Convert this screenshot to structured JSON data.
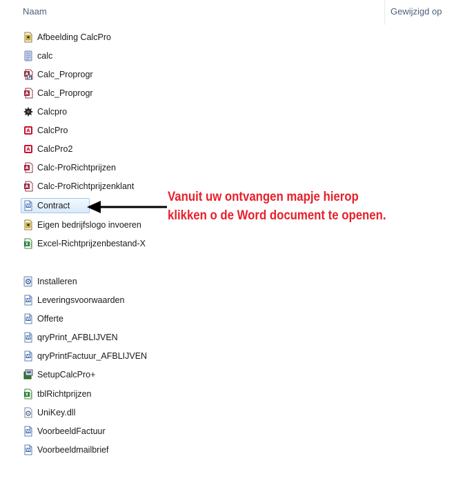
{
  "header": {
    "name_col": "Naam",
    "date_col": "Gewijzigd op"
  },
  "files": [
    {
      "name": "Afbeelding CalcPro",
      "icon": "image-file-icon"
    },
    {
      "name": "calc",
      "icon": "text-file-icon"
    },
    {
      "name": "Calc_Proprogr",
      "icon": "access-shortcut-icon"
    },
    {
      "name": "Calc_Proprogr",
      "icon": "access-db-icon"
    },
    {
      "name": "Calcpro",
      "icon": "program-icon"
    },
    {
      "name": "CalcPro",
      "icon": "access-app-icon"
    },
    {
      "name": "CalcPro2",
      "icon": "access-app-icon"
    },
    {
      "name": "Calc-ProRichtprijzen",
      "icon": "access-db-icon"
    },
    {
      "name": "Calc-ProRichtprijzenklant",
      "icon": "access-db-icon"
    },
    {
      "name": "Contract",
      "icon": "word-doc-icon"
    },
    {
      "name": "Eigen bedrijfslogo invoeren",
      "icon": "image-file-icon"
    },
    {
      "name": "Excel-Richtprijzenbestand-X",
      "icon": "excel-file-icon"
    },
    {
      "name": "Installeren",
      "icon": "setup-config-icon"
    },
    {
      "name": "Leveringsvoorwaarden",
      "icon": "word-doc-icon"
    },
    {
      "name": "Offerte",
      "icon": "word-doc-icon"
    },
    {
      "name": "qryPrint_AFBLIJVEN",
      "icon": "word-doc-icon"
    },
    {
      "name": "qryPrintFactuur_AFBLIJVEN",
      "icon": "word-doc-icon"
    },
    {
      "name": "SetupCalcPro+",
      "icon": "setup-installer-icon"
    },
    {
      "name": "tblRichtprijzen",
      "icon": "excel-file-icon"
    },
    {
      "name": "UniKey.dll",
      "icon": "dll-file-icon"
    },
    {
      "name": "VoorbeeldFactuur",
      "icon": "word-doc-icon"
    },
    {
      "name": "Voorbeeldmailbrief",
      "icon": "word-doc-icon"
    }
  ],
  "annotation": {
    "line1": "Vanuit uw ontvangen mapje hierop",
    "line2": "klikken o de Word document te openen."
  },
  "colors": {
    "annotation": "#e8202b",
    "selection_border": "#9fc6ee",
    "header_text": "#4c607a"
  }
}
